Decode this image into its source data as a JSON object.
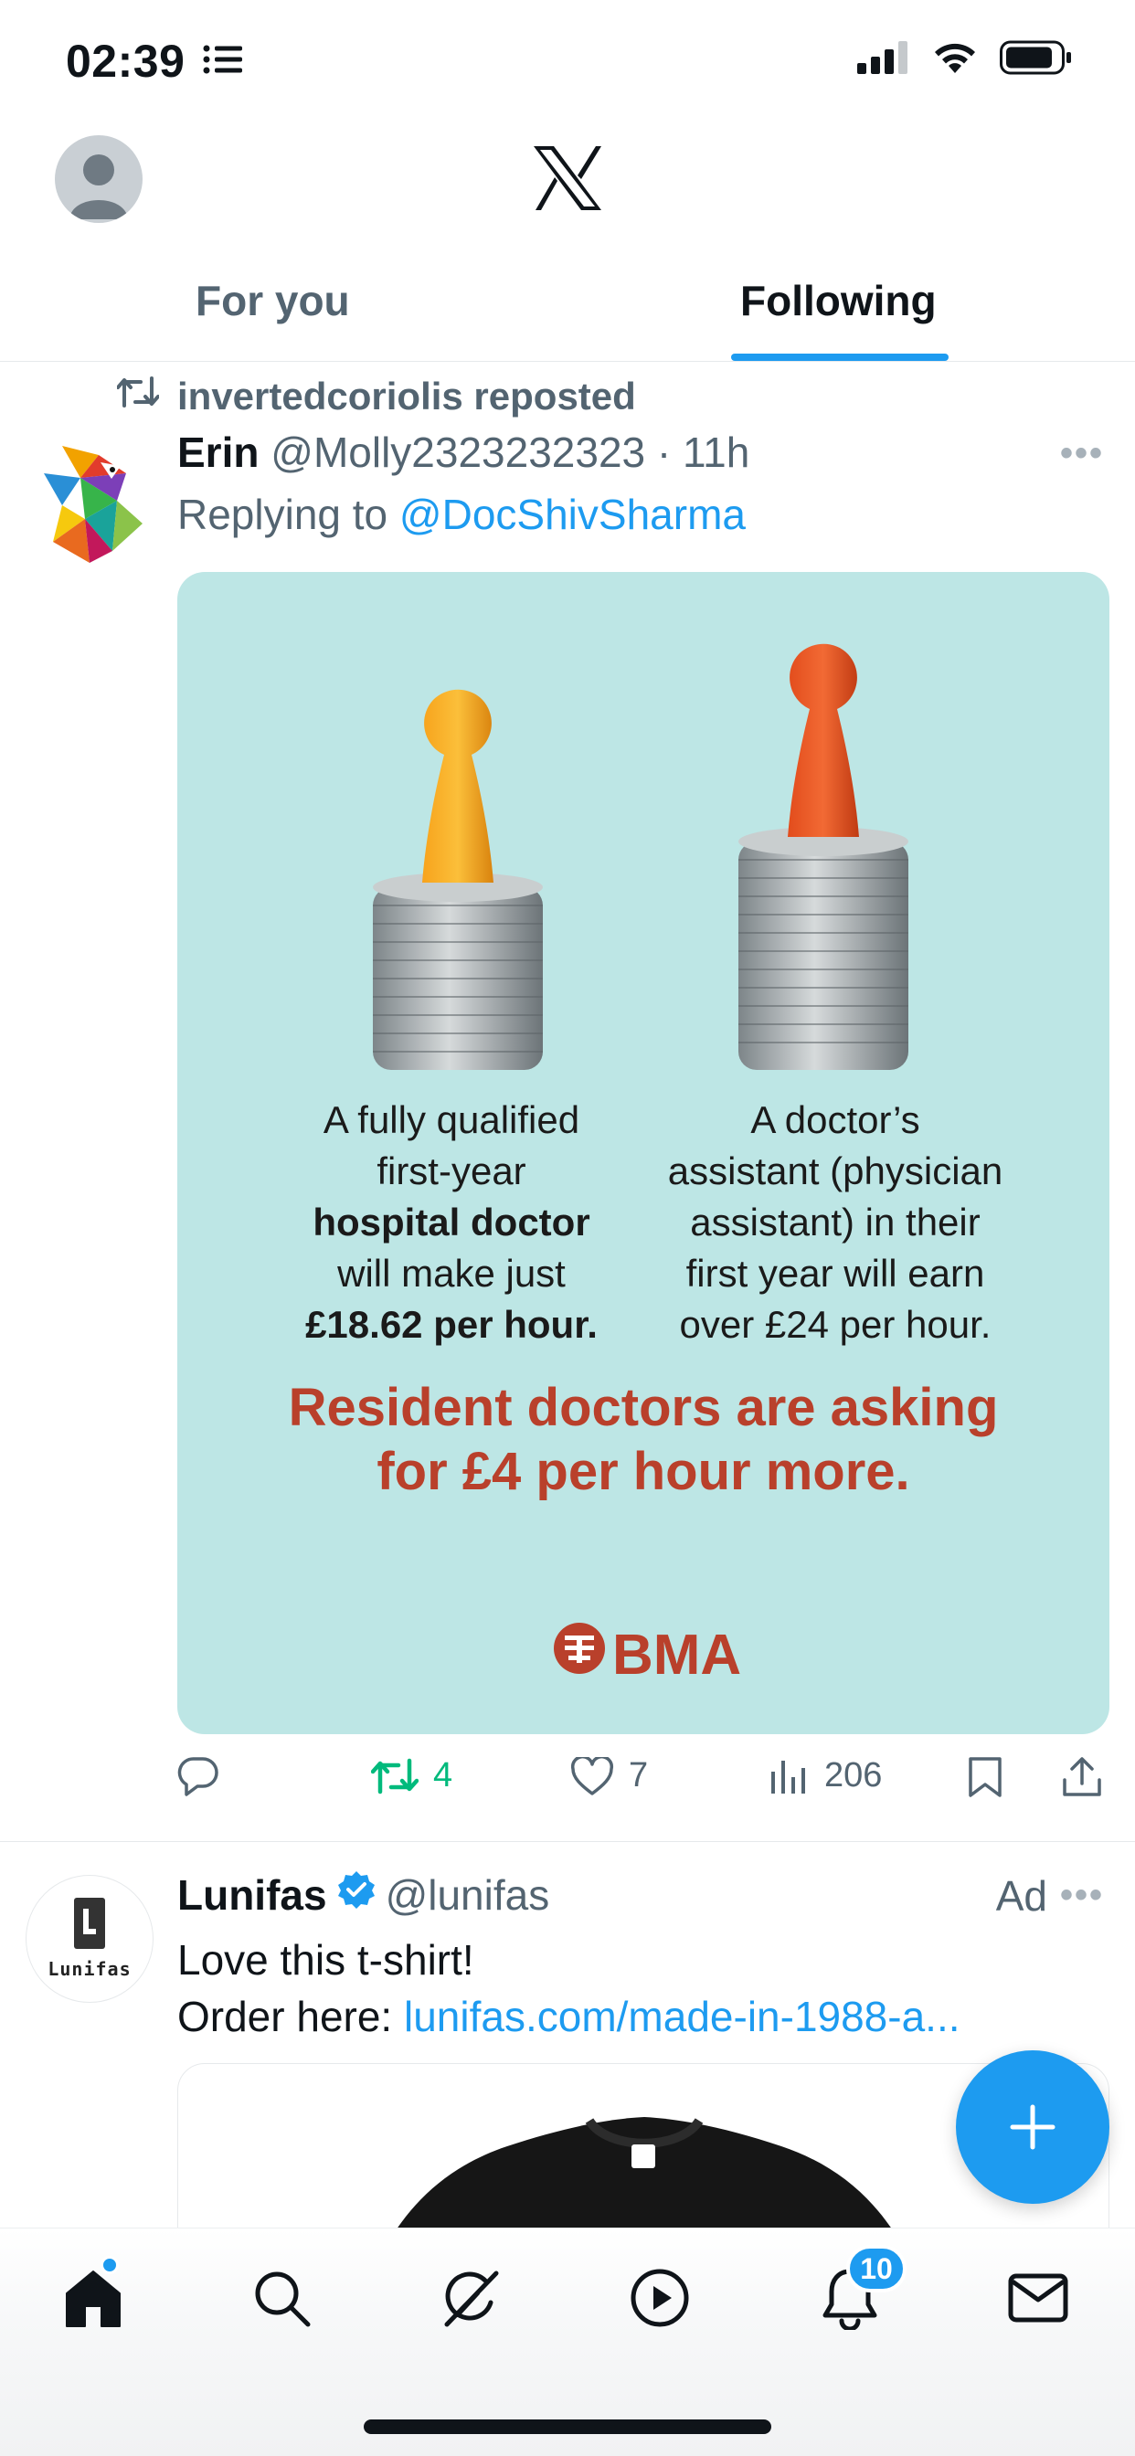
{
  "status_bar": {
    "time": "02:39"
  },
  "tabs": {
    "for_you": "For you",
    "following": "Following"
  },
  "tweet1": {
    "repost_text": "invertedcoriolis reposted",
    "name": "Erin",
    "handle_time": "@Molly2323232323 · 11h",
    "replying_prefix": "Replying to",
    "replying_mention": "@DocShivSharma",
    "image": {
      "left_text": [
        "A fully qualified",
        "first-year",
        "hospital doctor",
        "will make just",
        "£18.62 per hour."
      ],
      "right_text": [
        "A doctor’s",
        "assistant (physician",
        "assistant) in their",
        "first year will earn",
        "over £24 per hour."
      ],
      "headline_line1": "Resident doctors are asking",
      "headline_line2": "for £4 per hour more.",
      "brand": "BMA"
    },
    "actions": {
      "retweets": "4",
      "likes": "7",
      "views": "206"
    }
  },
  "tweet2": {
    "name": "Lunifas",
    "handle": "@lunifas",
    "ad_label": "Ad",
    "avatar_word": "Lunifas",
    "body_line1": "Love this t-shirt!",
    "body_prefix": "Order here:",
    "body_link": "lunifas.com/made-in-1988-a..."
  },
  "bottom_nav": {
    "notifications_badge": "10"
  },
  "colors": {
    "accent": "#1d9bf0",
    "retweet_green": "#00ba7c",
    "image_bg": "#bde6e5",
    "image_red": "#b9402b"
  }
}
